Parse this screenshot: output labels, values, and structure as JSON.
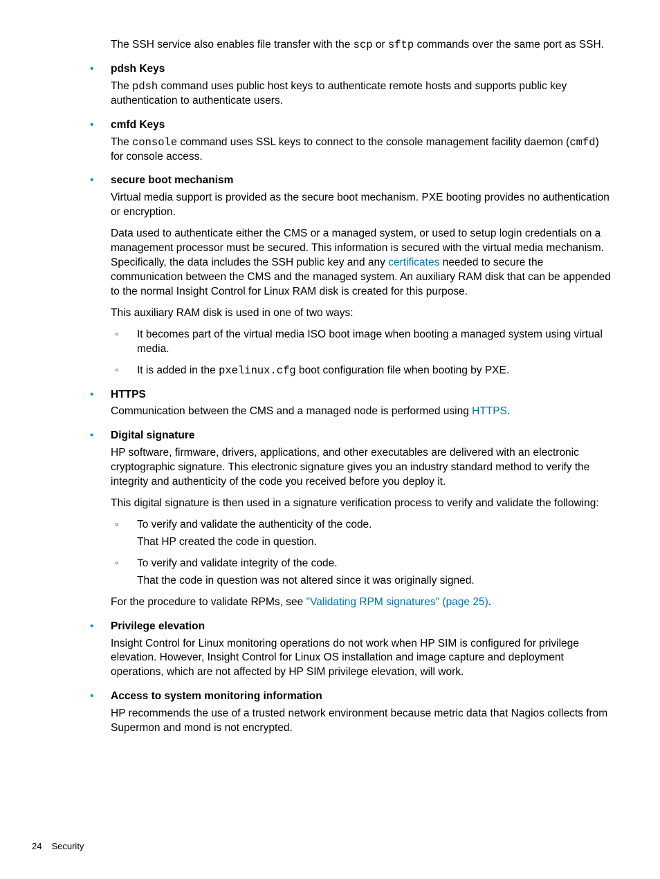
{
  "intro": {
    "pre": "The SSH service also enables file transfer with the ",
    "code1": "scp",
    "mid": " or ",
    "code2": "sftp",
    "post": " commands over the same port as SSH."
  },
  "items": {
    "pdsh": {
      "title": "pdsh Keys",
      "p1_pre": "The ",
      "p1_code": "pdsh",
      "p1_post": " command uses public host keys to authenticate remote hosts and supports public key authentication to authenticate users."
    },
    "cmfd": {
      "title": "cmfd Keys",
      "p1_pre": "The ",
      "p1_code1": "console",
      "p1_mid": " command uses SSL keys to connect to the console management facility daemon (",
      "p1_code2": "cmfd",
      "p1_post": ") for console access."
    },
    "secure": {
      "title": "secure boot mechanism",
      "p1": "Virtual media support is provided as the secure boot mechanism. PXE booting provides no authentication or encryption.",
      "p2_pre": "Data used to authenticate either the CMS or a managed system, or used to setup login credentials on a management processor must be secured. This information is secured with the virtual media mechanism. Specifically, the data includes the SSH public key and any ",
      "p2_link": "certificates",
      "p2_post": " needed to secure the communication between the CMS and the managed system. An auxiliary RAM disk that can be appended to the normal Insight Control for Linux RAM disk is created for this purpose.",
      "p3": "This auxiliary RAM disk is used in one of two ways:",
      "sub1": "It becomes part of the virtual media ISO boot image when booting a managed system using virtual media.",
      "sub2_pre": "It is added in the ",
      "sub2_code": "pxelinux.cfg",
      "sub2_post": " boot configuration file when booting by PXE."
    },
    "https": {
      "title": "HTTPS",
      "p1_pre": "Communication between the CMS and a managed node is performed using ",
      "p1_link": "HTTPS",
      "p1_post": "."
    },
    "digsig": {
      "title": "Digital signature",
      "p1": "HP software, firmware, drivers, applications, and other executables are delivered with an electronic cryptographic signature. This electronic signature gives you an industry standard method to verify the integrity and authenticity of the code you received before you deploy it.",
      "p2": "This digital signature is then used in a signature verification process to verify and validate the following:",
      "sub1a": "To verify and validate the authenticity of the code.",
      "sub1b": "That HP created the code in question.",
      "sub2a": "To verify and validate integrity of the code.",
      "sub2b": "That the code in question was not altered since it was originally signed.",
      "p3_pre": "For the procedure to validate RPMs, see ",
      "p3_link": "\"Validating RPM signatures\" (page 25)",
      "p3_post": "."
    },
    "priv": {
      "title": "Privilege elevation",
      "p1": "Insight Control for Linux monitoring operations do not work when HP SIM is configured for privilege elevation. However, Insight Control for Linux OS installation and image capture and deployment operations, which are not affected by HP SIM privilege elevation, will work."
    },
    "access": {
      "title": "Access to system monitoring information",
      "p1": "HP recommends the use of a trusted network environment because metric data that Nagios collects from Supermon and mond is not encrypted."
    }
  },
  "footer": {
    "page": "24",
    "section": "Security"
  }
}
